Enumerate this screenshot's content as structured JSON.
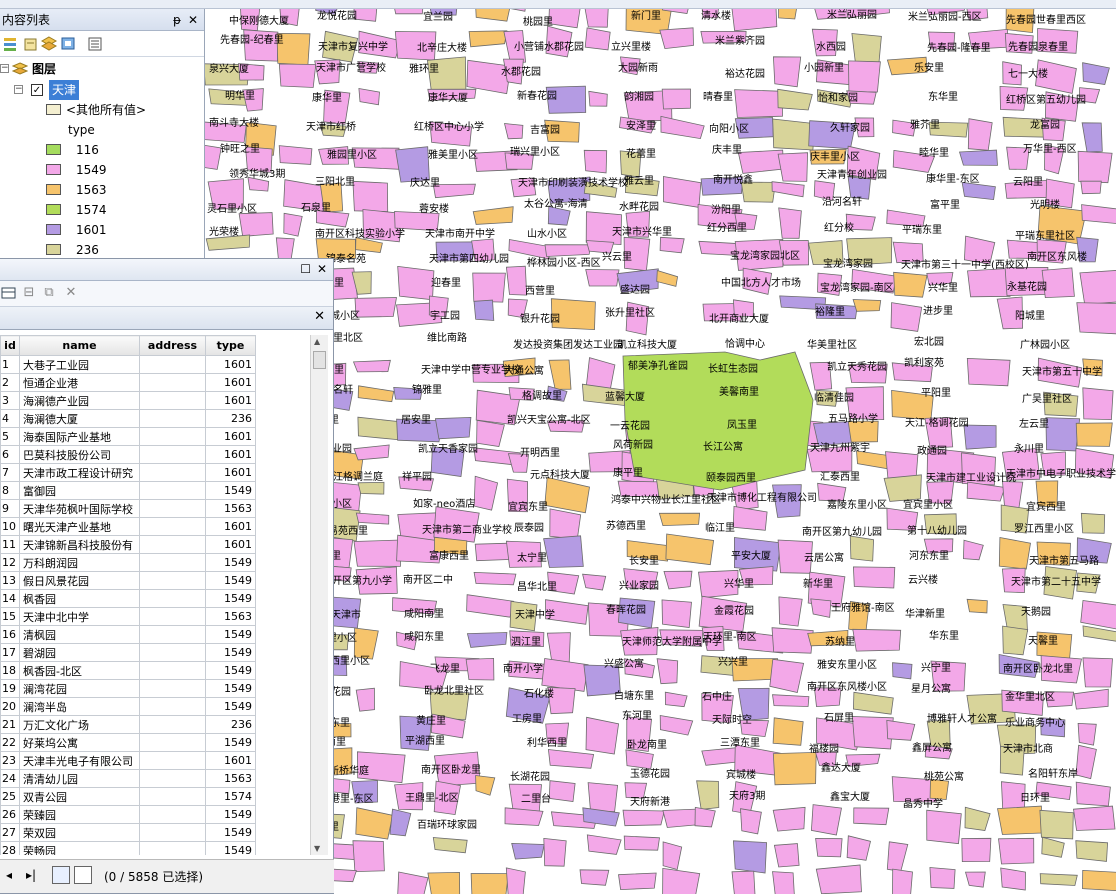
{
  "toc": {
    "title": "内容列表",
    "pin_glyph": "ᵽ",
    "close_glyph": "✕",
    "root_label": "图层",
    "layer_name": "天津",
    "other_values_label": "<其他所有值>",
    "field_label": "type",
    "legend": [
      {
        "value": "116",
        "color": "#a5dc5e"
      },
      {
        "value": "1549",
        "color": "#f3a8e8"
      },
      {
        "value": "1563",
        "color": "#f6c46c"
      },
      {
        "value": "1574",
        "color": "#b2dc5a"
      },
      {
        "value": "1601",
        "color": "#b49be3"
      },
      {
        "value": "236",
        "color": "#d8d49a"
      }
    ]
  },
  "attr_table": {
    "columns": [
      "id",
      "name",
      "address",
      "type"
    ],
    "rows": [
      [
        "1",
        "大巷子工业园",
        "",
        "1601"
      ],
      [
        "2",
        "恒通企业港",
        "",
        "1601"
      ],
      [
        "3",
        "海澜德产业园",
        "",
        "1601"
      ],
      [
        "4",
        "海澜德大厦",
        "",
        "236"
      ],
      [
        "5",
        "海泰国际产业基地",
        "",
        "1601"
      ],
      [
        "6",
        "巴莫科技股份公司",
        "",
        "1601"
      ],
      [
        "7",
        "天津市政工程设计研究",
        "",
        "1601"
      ],
      [
        "8",
        "富御园",
        "",
        "1549"
      ],
      [
        "9",
        "天津华苑枫叶国际学校",
        "",
        "1563"
      ],
      [
        "10",
        "曙光天津产业基地",
        "",
        "1601"
      ],
      [
        "11",
        "天津锦新昌科技股份有",
        "",
        "1601"
      ],
      [
        "12",
        "万科朗润园",
        "",
        "1549"
      ],
      [
        "13",
        "假日风景花园",
        "",
        "1549"
      ],
      [
        "14",
        "枫香园",
        "",
        "1549"
      ],
      [
        "15",
        "天津中北中学",
        "",
        "1563"
      ],
      [
        "16",
        "清枫园",
        "",
        "1549"
      ],
      [
        "17",
        "碧湖园",
        "",
        "1549"
      ],
      [
        "18",
        "枫香园-北区",
        "",
        "1549"
      ],
      [
        "19",
        "澜湾花园",
        "",
        "1549"
      ],
      [
        "20",
        "澜湾半岛",
        "",
        "1549"
      ],
      [
        "21",
        "万汇文化广场",
        "",
        "236"
      ],
      [
        "22",
        "好莱坞公寓",
        "",
        "1549"
      ],
      [
        "23",
        "天津丰光电子有限公司",
        "",
        "1601"
      ],
      [
        "24",
        "清清幼儿园",
        "",
        "1563"
      ],
      [
        "25",
        "双青公园",
        "",
        "1574"
      ],
      [
        "26",
        "荣臻园",
        "",
        "1549"
      ],
      [
        "27",
        "荣双园",
        "",
        "1549"
      ],
      [
        "28",
        "荣畅园",
        "",
        "1549"
      ]
    ],
    "status": "(0 / 5858 已选择)",
    "nav_first": "⏮",
    "nav_last": "▸|"
  },
  "map": {
    "pink": "#f3a8e8",
    "orange": "#f6c46c",
    "green": "#b2dc5a",
    "purple": "#b49be3",
    "khaki": "#d8d49a",
    "labels": [
      "中保刚德大厦",
      "龙悦花园",
      "宜兰园",
      "桃园里",
      "新门里",
      "清水楼",
      "米兰弘丽园",
      "米兰弘丽园-西区",
      "先春园世春里西区",
      "先春园-纪春里",
      "天津市复兴中学",
      "北辛庄大楼",
      "小营铺水郡花园",
      "立兴里楼",
      "米兰紫齐园",
      "水西园",
      "先春园-隆春里",
      "先春园泉春里",
      "泉兴大厦",
      "天津市广营学校",
      "雅环里",
      "水郡花园",
      "大园新雨",
      "裕达花园",
      "小园新里",
      "乐安里",
      "七一大楼",
      "明华里",
      "康华里",
      "康华大厦",
      "新春花园",
      "韵湘园",
      "晴春里",
      "怡和家园",
      "东华里",
      "红桥区第五幼儿园",
      "南斗寺大楼",
      "天津市红桥",
      "红桥区中心小学",
      "吉富园",
      "安泽里",
      "向阳小区",
      "久轩家园",
      "雅芥里",
      "龙富园",
      "钟旺之里",
      "雅园里小区",
      "雅美里小区",
      "瑞兴里小区",
      "花蕾里",
      "庆丰里",
      "庆丰里小区",
      "睦华里",
      "万华里-西区",
      "领秀华城3期",
      "三阳北里",
      "庆达里",
      "天津市印刷装潢技术学校",
      "雅云里",
      "南开悦鑫",
      "天津青年创业园",
      "康华里-东区",
      "云阳里",
      "灵石里小区",
      "石泉里",
      "蓉安楼",
      "太谷公寓-海清",
      "水畔花园",
      "汾阳里",
      "沿河名轩",
      "富平里",
      "光明楼",
      "光荣楼",
      "南开区科技实验小学",
      "天津市南开中学",
      "山水小区",
      "天津市兴华里",
      "红分西里",
      "红分校",
      "平瑞东里",
      "平瑞东里社区",
      "幸福北里",
      "锦泰名苑",
      "天津市第四幼儿园",
      "桦林园小区-西区",
      "兴云里",
      "宝龙湾家园北区",
      "宝龙湾家园",
      "天津市第三十一中学(西校区)",
      "南开区东风楼",
      "华安北里",
      "宜川北里",
      "迎春里",
      "西营里",
      "盛达园",
      "中国北方人才市场",
      "宝龙湾家园-南区",
      "兴华里",
      "永基花园",
      "南开区",
      "盛达城小区",
      "宇工园",
      "银升花园",
      "张升里社区",
      "北开商业大厦",
      "裕隆里",
      "进步里",
      "阳城里",
      "广埠大楼",
      "腾辉里北区",
      "维比南路",
      "发达投资集团发达工业园",
      "凯立科技大厦",
      "恰调中心",
      "华美里社区",
      "宏北园",
      "广林园小区",
      "合北里",
      "广泉里",
      "天津中学中营专业学校",
      "大通公寓",
      "郁美净孔雀园",
      "长虹生态园",
      "凯立天秀花园",
      "凯利家苑",
      "天津市第五十中学",
      "格调香天花园",
      "广益名轩",
      "锦雅里",
      "格调故里",
      "蓝馨大厦",
      "美馨南里",
      "临清佳园",
      "平阳里",
      "广吴里社区",
      "C92创意聚区",
      "武乡里",
      "居安里",
      "凯兴天宝公寓-北区",
      "一云花园",
      "凤玉里",
      "五马路小学",
      "天江-格调花园",
      "左云里",
      "隆庆琴墨",
      "科技产业园",
      "凯立天香家园",
      "开明西里",
      "风荷新园",
      "长江公寓",
      "天津九州紫宇",
      "政通园",
      "永川里",
      "京银科技大厦",
      "天江格调兰庭",
      "祥平园",
      "元点科技大厦",
      "康平里",
      "颐泰园西里",
      "汇泰西里",
      "天津市建工业设计院",
      "天津市中电子职业技术学校",
      "鼎元北里",
      "鼎元小区",
      "如家-neo酒店",
      "宜宾东里",
      "鸿泰中兴物业长江里社区",
      "天津市博化工程有限公司",
      "嘉陵东里小区",
      "宜宾里小区",
      "宜宾西里",
      "长治里",
      "易苑西里",
      "天津市第二商业学校",
      "辰泰园",
      "苏德西里",
      "临江里",
      "南开区第九幼儿园",
      "第十八幼儿园",
      "罗江西里小区",
      "罗江东里",
      "临江里",
      "富康西里",
      "太宁里",
      "长安里",
      "平安大厦",
      "云居公寓",
      "河东东里",
      "天津市第五马路",
      "咸阳北里",
      "南开区第九小学",
      "南开区二中",
      "昌华北里",
      "兴业家园",
      "兴华里",
      "新华里",
      "云兴楼",
      "天津市第二十五中学",
      "兴华公寓",
      "天津市",
      "咸阳南里",
      "天津中学",
      "春晖花园",
      "金霞花园",
      "王府雅馆-南区",
      "华津新里",
      "天鹅园",
      "东斗里-北区",
      "西山里小区",
      "咸阳东里",
      "泗江里",
      "天津师范大学附属中学",
      "天环里-南区",
      "苏纳里",
      "华东里",
      "天馨里",
      "飞云里小区",
      "三潭西里小区",
      "飞龙里",
      "南开小学",
      "兴盛公寓",
      "兴兴里",
      "雅安东里小区",
      "兴宁里",
      "南开区卧龙北里",
      "天瀛路",
      "万焦花园",
      "卧龙北里社区",
      "石化楼",
      "白塘东里",
      "石中庄",
      "南开区东风楼小区",
      "星月公寓",
      "金华里北区",
      "天津市南开区五面东里",
      "和平东里",
      "黄庄里",
      "工房里",
      "东河里",
      "天际时空",
      "石屏里",
      "博雅轩人才公寓",
      "乐业商务中心",
      "地铁里",
      "云龙南里",
      "平湖西里",
      "利华西里",
      "卧龙南里",
      "三潭东里",
      "福楼园",
      "鑫屏公寓",
      "天津市北商",
      "平湖路社区",
      "新桥华庭",
      "南开区卧龙里",
      "长湖花园",
      "玉德花园",
      "宾城楼",
      "鑫达大厦",
      "桃苑公寓",
      "名阳轩东岸",
      "花港里-西区",
      "花港里-东区",
      "王鼎里-北区",
      "二里台",
      "天府新港",
      "天府3期",
      "鑫宝大厦",
      "晶秀中学",
      "日环里",
      "湖景里",
      "石碑里",
      "百瑞环球家园"
    ]
  }
}
